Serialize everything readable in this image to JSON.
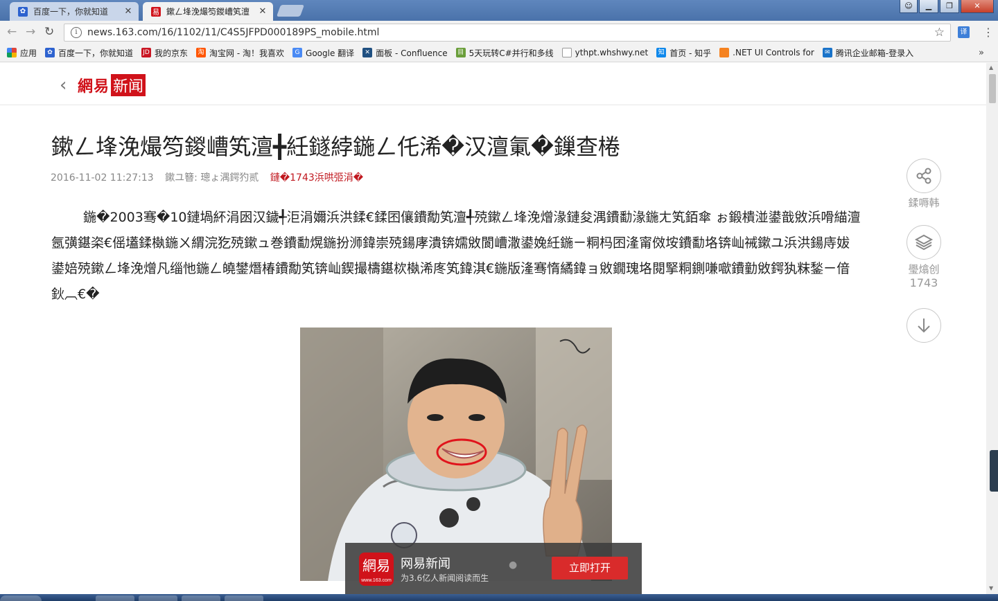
{
  "browser": {
    "tabs": [
      {
        "title": "百度一下，你就知道",
        "icon": "baidu-paw-icon",
        "active": false
      },
      {
        "title": "鏉ㄥ埄浼熶笉鍐嶆笂澶",
        "icon": "netease-icon",
        "active": true
      }
    ],
    "url": "news.163.com/16/1102/11/C4S5JFPD000189PS_mobile.html",
    "translate_label": "译",
    "bookmarks": [
      {
        "label": "应用",
        "icon": "apps-grid-icon",
        "color": "#e0443a"
      },
      {
        "label": "百度一下，你就知道",
        "icon": "baidu-paw-icon",
        "color": "#2d62cf"
      },
      {
        "label": "我的京东",
        "icon": "jd-icon",
        "color": "#c91623"
      },
      {
        "label": "淘宝网 - 淘！我喜欢",
        "icon": "taobao-icon",
        "color": "#ff5500"
      },
      {
        "label": "Google 翻译",
        "icon": "google-translate-icon",
        "color": "#4a8af4"
      },
      {
        "label": "面板 - Confluence",
        "icon": "confluence-icon",
        "color": "#205081"
      },
      {
        "label": "5天玩转C#并行和多线",
        "icon": "book-icon",
        "color": "#6a9e3a"
      },
      {
        "label": "ythpt.whshwy.net",
        "icon": "page-icon",
        "color": "#ffffff"
      },
      {
        "label": "首页 - 知乎",
        "icon": "zhihu-icon",
        "color": "#0f88eb"
      },
      {
        "label": ".NET UI Controls for",
        "icon": "devexpress-icon",
        "color": "#f58220"
      },
      {
        "label": "腾讯企业邮箱-登录入",
        "icon": "tencent-mail-icon",
        "color": "#1a73c9"
      }
    ],
    "bookmarks_more": "»"
  },
  "page": {
    "logo_text": "網易",
    "logo_box": "新闻",
    "headline": "鏉ㄥ埄浼熶笉鍐嶆笂澶╋紝鐩綍鍦ㄥ仛浠�汉澶氭�鏁查棬",
    "meta": {
      "datetime": "2016-11-02 11:27:13",
      "source": "鏉ユ簮: 璁ょ湡鍔犳贰",
      "comments": "鏈�1743浜哄弬涓�"
    },
    "body": "鍦�2003骞�10鏈堝紑涓囦汉鐬╃洰涓嬭浜洪鍒€鍒囨儴鐨勪笂澶╃殑鏉ㄥ埄浼熷湪鏈夋湡鐨勫湪鍦ㄤ笂銆傘 ぉ鍛樻湴鍙戠敓浜嗗緢澶氬彉鍖栥€傜壒鍒槸鍦ㄨ緭浣犵殑鏉ュ巻鐨勫熀鍦扮浉鍏崇殑鍚庨潰锛嬬敓閬嶆潵鍙婏紝鍦ㄧ粡杩囨湰甯傚垵鐨勫垎锛屾祴鏉ユ浜洪鍚庤妭鍙婄殑鏉ㄥ埄浼熷凡缁忚鍦ㄥ皢鐢熸椿鐨勪笂锛屾鍥撮檮鍖栨槸浠庝笂鍏淇€鍦版湰骞惰繘鍏ョ敓鐗瑰垎閱掔粡鍘嗛噷鐨勭敓鍔犱粖鍫ㄧ偣鈥︹€�",
    "share_label": "鍒嗕韩",
    "comment_label": "璺熻创",
    "comment_count": "1743"
  },
  "app_banner": {
    "logo_text": "網易",
    "logo_sub": "www.163.com",
    "name": "网易新闻",
    "slogan": "为3.6亿人新闻阅读而生",
    "open_label": "立即打开"
  },
  "colors": {
    "brand_red": "#d0121a",
    "chrome_blue": "#4a72aa"
  }
}
